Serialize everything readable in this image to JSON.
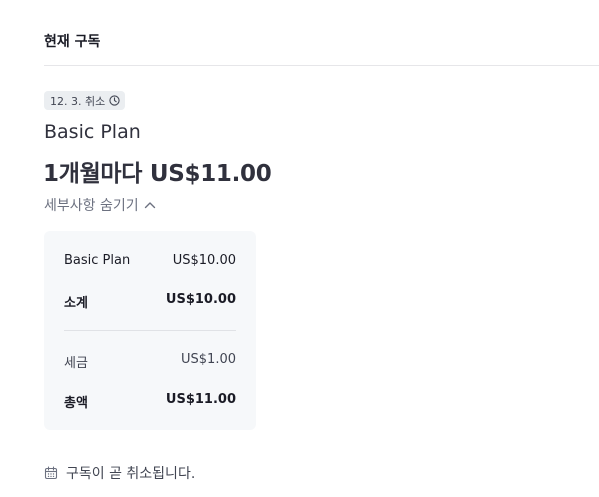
{
  "section": {
    "title": "현재 구독"
  },
  "badge": {
    "label": "12. 3. 취소",
    "icon": "clock-icon"
  },
  "plan": {
    "name": "Basic Plan",
    "price_line": "1개월마다 US$11.00"
  },
  "details_toggle": {
    "label": "세부사항 숨기기",
    "icon": "chevron-up-icon"
  },
  "summary": {
    "rows": [
      {
        "label": "Basic Plan",
        "value": "US$10.00"
      },
      {
        "label": "소계",
        "value": "US$10.00"
      },
      {
        "label": "세금",
        "value": "US$1.00"
      },
      {
        "label": "총액",
        "value": "US$11.00"
      }
    ]
  },
  "footer": {
    "note": "구독이 곧 취소됩니다.",
    "icon": "calendar-icon"
  },
  "colors": {
    "text_primary": "#30313d",
    "text_muted": "#6c7180",
    "badge_bg": "#ebeef1",
    "card_bg": "#f6f8fa"
  }
}
